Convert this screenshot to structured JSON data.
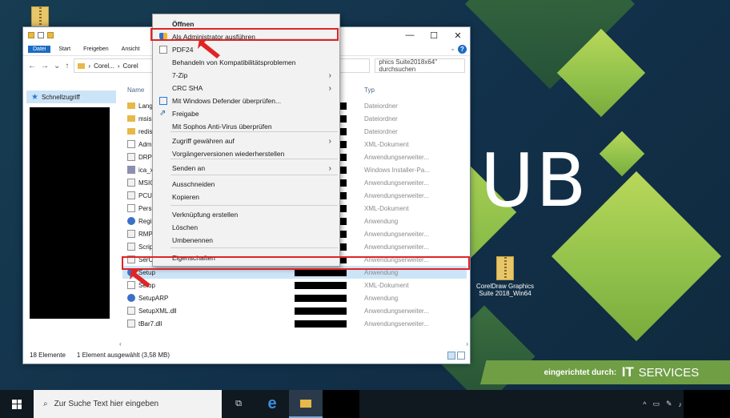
{
  "desktop": {
    "brand_text": "UB",
    "brand_prefix": "eingerichtet durch:",
    "brand_it": "IT",
    "brand_services": "SERVICES",
    "desktop_icon_label_line1": "CorelDraw Graphics",
    "desktop_icon_label_line2": "Suite 2018_Win64",
    "accent_green": "#8fc04a"
  },
  "explorer": {
    "tabs": [
      "Datei",
      "Start",
      "Freigeben",
      "Ansicht"
    ],
    "breadcrumb": [
      "Corel...",
      "Corel"
    ],
    "search_placeholder": "phics Suite2018x64\" durchsuchen",
    "nav_quick_access": "Schnellzugriff",
    "columns": {
      "name": "Name",
      "type": "Typ"
    },
    "files": [
      {
        "name": "Lang",
        "icon": "folder-icon",
        "type": "Dateiordner"
      },
      {
        "name": "msis",
        "icon": "folder-icon",
        "type": "Dateiordner"
      },
      {
        "name": "redist",
        "icon": "folder-icon",
        "type": "Dateiordner"
      },
      {
        "name": "Adm",
        "icon": "xml-file-icon",
        "type": "XML-Dokument"
      },
      {
        "name": "DRPC",
        "icon": "dll-file-icon",
        "type": "Anwendungserweiter..."
      },
      {
        "name": "ica_x6",
        "icon": "msi-file-icon",
        "type": "Windows Installer-Pa..."
      },
      {
        "name": "MSIC",
        "icon": "dll-file-icon",
        "type": "Anwendungserweiter..."
      },
      {
        "name": "PCUI",
        "icon": "dll-file-icon",
        "type": "Anwendungserweiter..."
      },
      {
        "name": "Persis",
        "icon": "xml-file-icon",
        "type": "XML-Dokument"
      },
      {
        "name": "Regis",
        "icon": "app-icon",
        "type": "Anwendung"
      },
      {
        "name": "RMPI",
        "icon": "dll-file-icon",
        "type": "Anwendungserweiter..."
      },
      {
        "name": "Scrip",
        "icon": "dll-file-icon",
        "type": "Anwendungserweiter..."
      },
      {
        "name": "SerCl",
        "icon": "dll-file-icon",
        "type": "Anwendungserweiter..."
      },
      {
        "name": "Setup",
        "icon": "app-icon",
        "type": "Anwendung",
        "selected": true
      },
      {
        "name": "Setup",
        "icon": "xml-file-icon",
        "type": "XML-Dokument"
      },
      {
        "name": "SetupARP",
        "icon": "app-icon",
        "type": "Anwendung"
      },
      {
        "name": "SetupXML.dll",
        "icon": "dll-file-icon",
        "type": "Anwendungserweiter..."
      },
      {
        "name": "tBar7.dll",
        "icon": "dll-file-icon",
        "type": "Anwendungserweiter..."
      }
    ],
    "status_count": "18 Elemente",
    "status_selection": "1 Element ausgewählt (3,58 MB)"
  },
  "context_menu": {
    "items": [
      {
        "label": "Öffnen",
        "bold": true
      },
      {
        "label": "Als Administrator ausführen",
        "icon": "uac-shield-icon",
        "highlighted": true
      },
      {
        "label": "PDF24",
        "icon": "pdf-document-icon"
      },
      {
        "label": "Behandeln von Kompatibilitätsproblemen"
      },
      {
        "label": "7-Zip",
        "submenu": true
      },
      {
        "label": "CRC SHA",
        "submenu": true
      },
      {
        "label": "Mit Windows Defender überprüfen...",
        "icon": "windows-defender-icon"
      },
      {
        "label": "Freigabe",
        "icon": "share-icon"
      },
      {
        "label": "Mit Sophos Anti-Virus überprüfen"
      },
      {
        "label": "Zugriff gewähren auf",
        "submenu": true
      },
      {
        "label": "Vorgängerversionen wiederherstellen"
      },
      {
        "label": "Senden an",
        "submenu": true
      },
      {
        "label": "Ausschneiden"
      },
      {
        "label": "Kopieren"
      },
      {
        "label": "Verknüpfung erstellen"
      },
      {
        "label": "Löschen"
      },
      {
        "label": "Umbenennen"
      },
      {
        "label": "Eigenschaften"
      }
    ]
  },
  "taskbar": {
    "search_placeholder": "Zur Suche Text hier eingeben",
    "apps": [
      "task-view-icon",
      "edge-icon",
      "file-explorer-icon"
    ]
  },
  "annotations": {
    "highlight_color": "#e02424"
  }
}
